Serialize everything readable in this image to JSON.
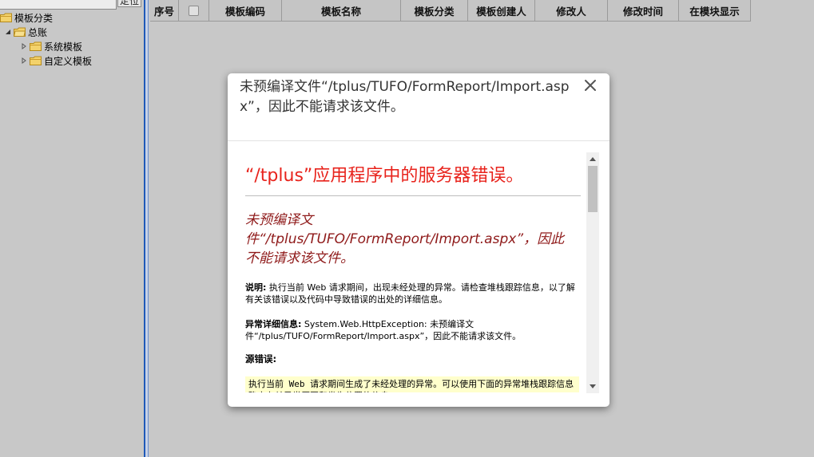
{
  "tree": {
    "search_placeholder": "",
    "locate_label": "定位",
    "root_label": "模板分类",
    "account_label": "总账",
    "system_label": "系统模板",
    "custom_label": "自定义模板"
  },
  "grid": {
    "columns": [
      "序号",
      "",
      "模板编码",
      "模板名称",
      "模板分类",
      "模板创建人",
      "修改人",
      "修改时间",
      "在模块显示"
    ]
  },
  "dialog": {
    "title": "未预编译文件“/tplus/TUFO/FormReport/Import.aspx”，因此不能请求该文件。",
    "error_heading": "“/tplus”应用程序中的服务器错误。",
    "error_subheading": "未预编译文件“/tplus/TUFO/FormReport/Import.aspx”，因此不能请求该文件。",
    "desc_label": "说明:",
    "desc_text": " 执行当前 Web 请求期间，出现未经处理的异常。请检查堆栈跟踪信息，以了解有关该错误以及代码中导致错误的出处的详细信息。",
    "exception_label": "异常详细信息:",
    "exception_text": " System.Web.HttpException: 未预编译文件“/tplus/TUFO/FormReport/Import.aspx”，因此不能请求该文件。",
    "source_label": "源错误:",
    "source_code": "执行当前 Web 请求期间生成了未经处理的异常。可以使用下面的异常堆栈跟踪信息确定有关异常原因和发生位置的信息。"
  },
  "colors": {
    "error_red": "#e8231c",
    "error_darkred": "#8f1a1a",
    "code_bg": "#ffffcc",
    "splitter_blue": "#1f59b8"
  }
}
